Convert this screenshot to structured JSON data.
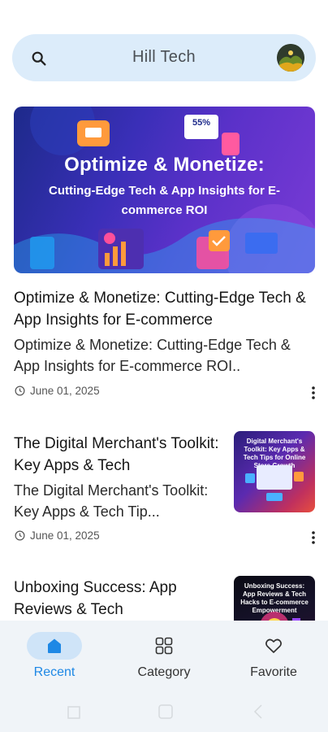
{
  "search": {
    "title": "Hill Tech",
    "icon": "search-icon",
    "avatar_icon": "logo-icon"
  },
  "featured": {
    "image_title": "Optimize & Monetize:",
    "image_subtitle": "Cutting-Edge Tech & App Insights for E-commerce ROI",
    "image_badge": "55%",
    "title": "Optimize & Monetize: Cutting-Edge Tech & App Insights for E-commerce",
    "excerpt": "Optimize & Monetize: Cutting-Edge Tech & App Insights for E-commerce ROI..",
    "date": "June 01, 2025"
  },
  "articles": [
    {
      "title": "The Digital Merchant's Toolkit: Key Apps & Tech",
      "excerpt": "The Digital Merchant's Toolkit: Key Apps & Tech Tip...",
      "date": "June 01, 2025",
      "thumb_text": "Digital Merchant's Toolkit: Key Apps & Tech Tips for Online Store Growth"
    },
    {
      "title": "Unboxing Success: App Reviews & Tech",
      "thumb_text": "Unboxing Success: App Reviews & Tech Hacks to E-commerce Empowerment"
    }
  ],
  "nav": {
    "recent": "Recent",
    "category": "Category",
    "favorite": "Favorite"
  },
  "colors": {
    "accent": "#1e88e5",
    "search_bg": "#dcecfa",
    "nav_bg": "#f0f4f8",
    "pill": "#cfe4f8"
  }
}
